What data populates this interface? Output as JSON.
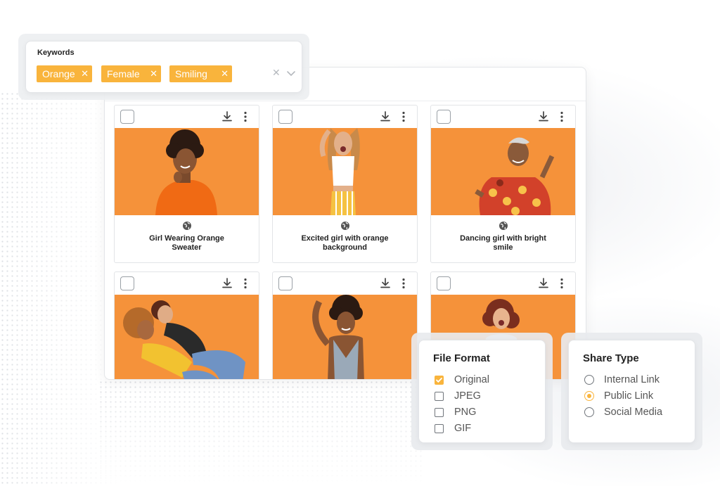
{
  "keywords": {
    "label": "Keywords",
    "tags": [
      "Orange",
      "Female",
      "Smiling"
    ],
    "clear_icon": "close-icon",
    "dropdown_icon": "chevron-down-icon"
  },
  "assets": [
    {
      "title": "Girl Wearing Orange Sweater",
      "visibility_icon": "globe-icon"
    },
    {
      "title": "Excited girl with orange background",
      "visibility_icon": "globe-icon"
    },
    {
      "title": "Dancing girl with bright smile",
      "visibility_icon": "globe-icon"
    },
    {
      "title": ""
    },
    {
      "title": ""
    },
    {
      "title": ""
    }
  ],
  "file_format": {
    "title": "File Format",
    "options": [
      {
        "label": "Original",
        "checked": true
      },
      {
        "label": "JPEG",
        "checked": false
      },
      {
        "label": "PNG",
        "checked": false
      },
      {
        "label": "GIF",
        "checked": false
      }
    ]
  },
  "share_type": {
    "title": "Share Type",
    "options": [
      {
        "label": "Internal Link",
        "selected": false
      },
      {
        "label": "Public Link",
        "selected": true
      },
      {
        "label": "Social Media",
        "selected": false
      }
    ]
  },
  "colors": {
    "accent": "#f9b43c",
    "photo_background": "#f5923a"
  }
}
